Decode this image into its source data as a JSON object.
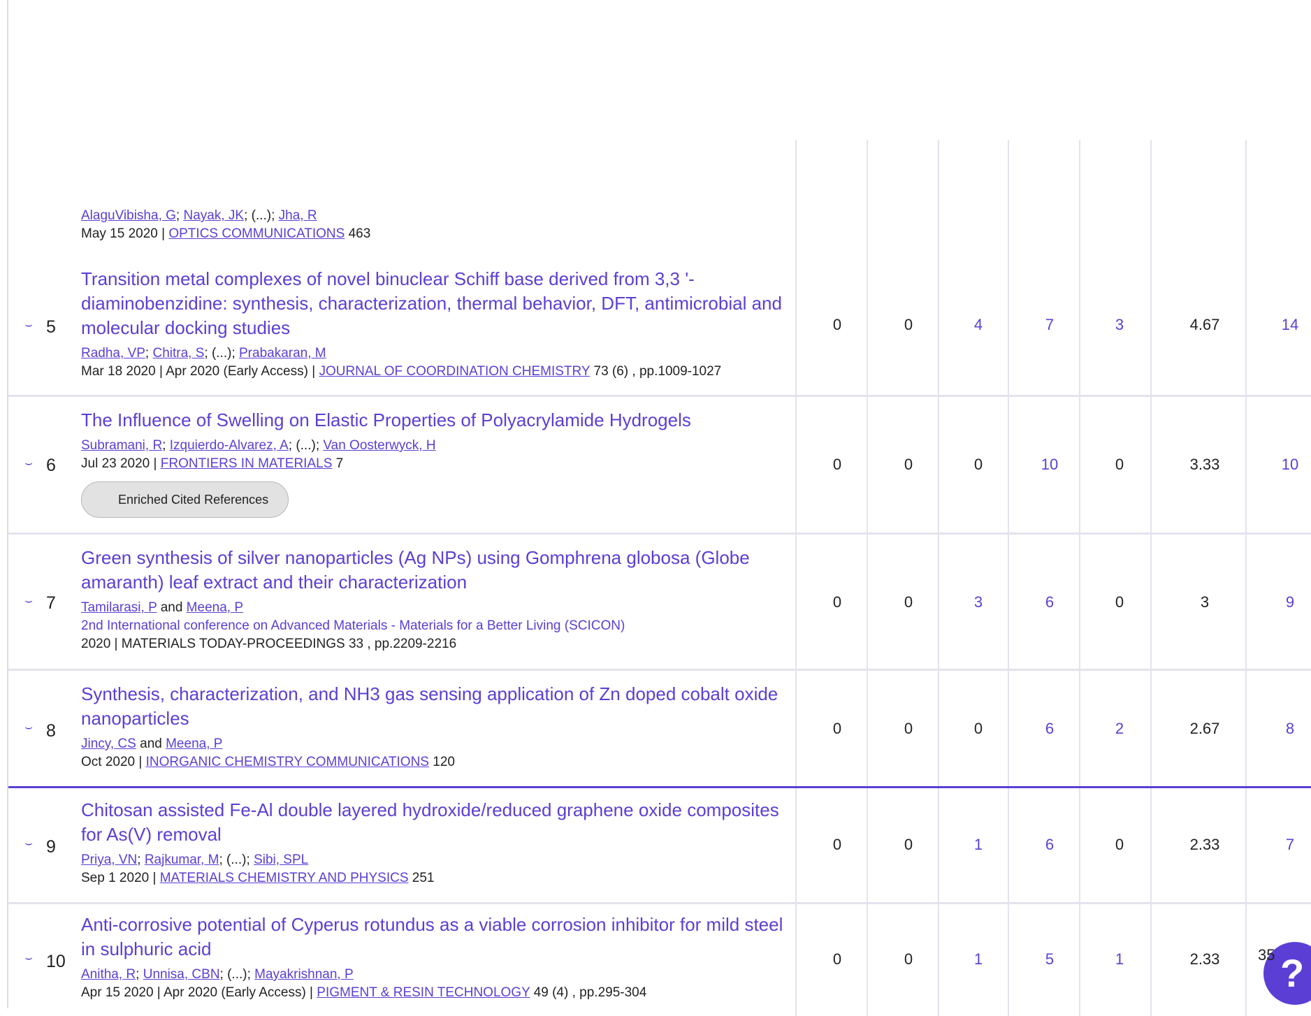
{
  "rows": [
    {
      "partial": true,
      "authors": [
        "AlaguVibisha, G",
        "Nayak, JK",
        "Jha, R"
      ],
      "meta_prefix": "May 15 2020 | ",
      "journal": "OPTICS COMMUNICATIONS",
      "meta_suffix": " 463"
    },
    {
      "rank": "5",
      "title": "Transition metal complexes of novel binuclear Schiff base derived from 3,3 '-diaminobenzidine: synthesis, characterization, thermal behavior, DFT, antimicrobial and molecular docking studies",
      "authors": [
        "Radha, VP",
        "Chitra, S",
        "Prabakaran, M"
      ],
      "meta_prefix": "Mar 18 2020 | Apr 2020 (Early Access) | ",
      "journal": "JOURNAL OF COORDINATION CHEMISTRY",
      "meta_suffix": " 73 (6) , pp.1009-1027",
      "values": [
        "0",
        "0",
        "4",
        "7",
        "3",
        "4.67",
        "14"
      ]
    },
    {
      "rank": "6",
      "title": "The Influence of Swelling on Elastic Properties of Polyacrylamide Hydrogels",
      "authors": [
        "Subramani, R",
        "Izquierdo-Alvarez, A",
        "Van Oosterwyck, H"
      ],
      "meta_prefix": "Jul 23 2020 | ",
      "journal": "FRONTIERS IN MATERIALS",
      "meta_suffix": " 7",
      "button": "Enriched Cited References",
      "values": [
        "0",
        "0",
        "0",
        "10",
        "0",
        "3.33",
        "10"
      ]
    },
    {
      "rank": "7",
      "title": "Green synthesis of silver nanoparticles (Ag NPs) using Gomphrena globosa (Globe amaranth) leaf extract and their characterization",
      "authors": [
        "Tamilarasi, P",
        "Meena, P"
      ],
      "conference": "2nd International conference on Advanced Materials - Materials for a Better Living (SCICON)",
      "meta_prefix": "2020 | MATERIALS TODAY-PROCEEDINGS 33 , pp.2209-2216",
      "values": [
        "0",
        "0",
        "3",
        "6",
        "0",
        "3",
        "9"
      ]
    },
    {
      "rank": "8",
      "title": "Synthesis, characterization, and NH3 gas sensing application of Zn doped cobalt oxide nanoparticles",
      "authors": [
        "Jincy, CS",
        "Meena, P"
      ],
      "meta_prefix": "Oct 2020 | ",
      "journal": "INORGANIC CHEMISTRY COMMUNICATIONS",
      "meta_suffix": " 120",
      "values": [
        "0",
        "0",
        "0",
        "6",
        "2",
        "2.67",
        "8"
      ]
    },
    {
      "rank": "9",
      "title": "Chitosan assisted Fe-Al double layered hydroxide/reduced graphene oxide composites for As(V) removal",
      "authors": [
        "Priya, VN",
        "Rajkumar, M",
        "Sibi, SPL"
      ],
      "meta_prefix": "Sep 1 2020 | ",
      "journal": "MATERIALS CHEMISTRY AND PHYSICS",
      "meta_suffix": " 251",
      "values": [
        "0",
        "0",
        "1",
        "6",
        "0",
        "2.33",
        "7"
      ]
    },
    {
      "rank": "10",
      "title": "Anti-corrosive potential of Cyperus rotundus as a viable corrosion inhibitor for mild steel in sulphuric acid",
      "authors": [
        "Anitha, R",
        "Unnisa, CBN",
        "Mayakrishnan, P"
      ],
      "meta_prefix": "Apr 15 2020 | Apr 2020 (Early Access) | ",
      "journal": "PIGMENT & RESIN TECHNOLOGY",
      "meta_suffix": " 49 (4) , pp.295-304",
      "values": [
        "0",
        "0",
        "1",
        "5",
        "1",
        "2.33",
        "35"
      ]
    }
  ],
  "labels": {
    "and": "and",
    "ellipsis": "; (...); ",
    "sep": "; "
  },
  "help": {
    "icon": "?",
    "count": "35"
  },
  "colors": {
    "accent": "#5b3fd4",
    "rule": "#e3e3ee"
  }
}
